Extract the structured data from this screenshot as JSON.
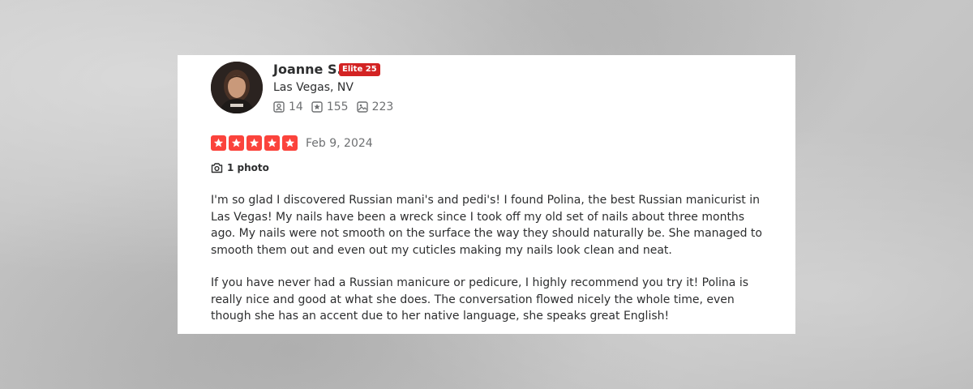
{
  "user": {
    "name": "Joanne S.",
    "elite_badge": "Elite 25",
    "location": "Las Vegas, NV",
    "stats": {
      "friends": "14",
      "reviews": "155",
      "photos": "223"
    }
  },
  "review": {
    "rating": 5,
    "rating_max": 5,
    "date": "Feb 9, 2024",
    "photos_label": "1 photo",
    "paragraphs": [
      "I'm so glad I discovered Russian mani's and pedi's! I found Polina, the best Russian manicurist in Las Vegas! My nails have been a wreck since I took off my old set of nails about three months ago. My nails were not smooth on the surface the way they should naturally be. She managed to smooth them out and even out my cuticles making my nails look clean and neat.",
      "If you have never had a Russian manicure or pedicure, I highly recommend you try it! Polina is really nice and good at what she does. The conversation flowed nicely the whole time, even though she has an accent due to her native language, she speaks great English!"
    ]
  },
  "colors": {
    "star_fill": "#fb433c",
    "elite_badge_bg": "#d32323",
    "text_primary": "#2d2e2f",
    "text_secondary": "#6e7072"
  },
  "icons": {
    "friends": "friends-icon",
    "reviews": "review-star-icon",
    "photos": "photos-icon",
    "camera": "camera-icon",
    "star": "star-icon"
  }
}
